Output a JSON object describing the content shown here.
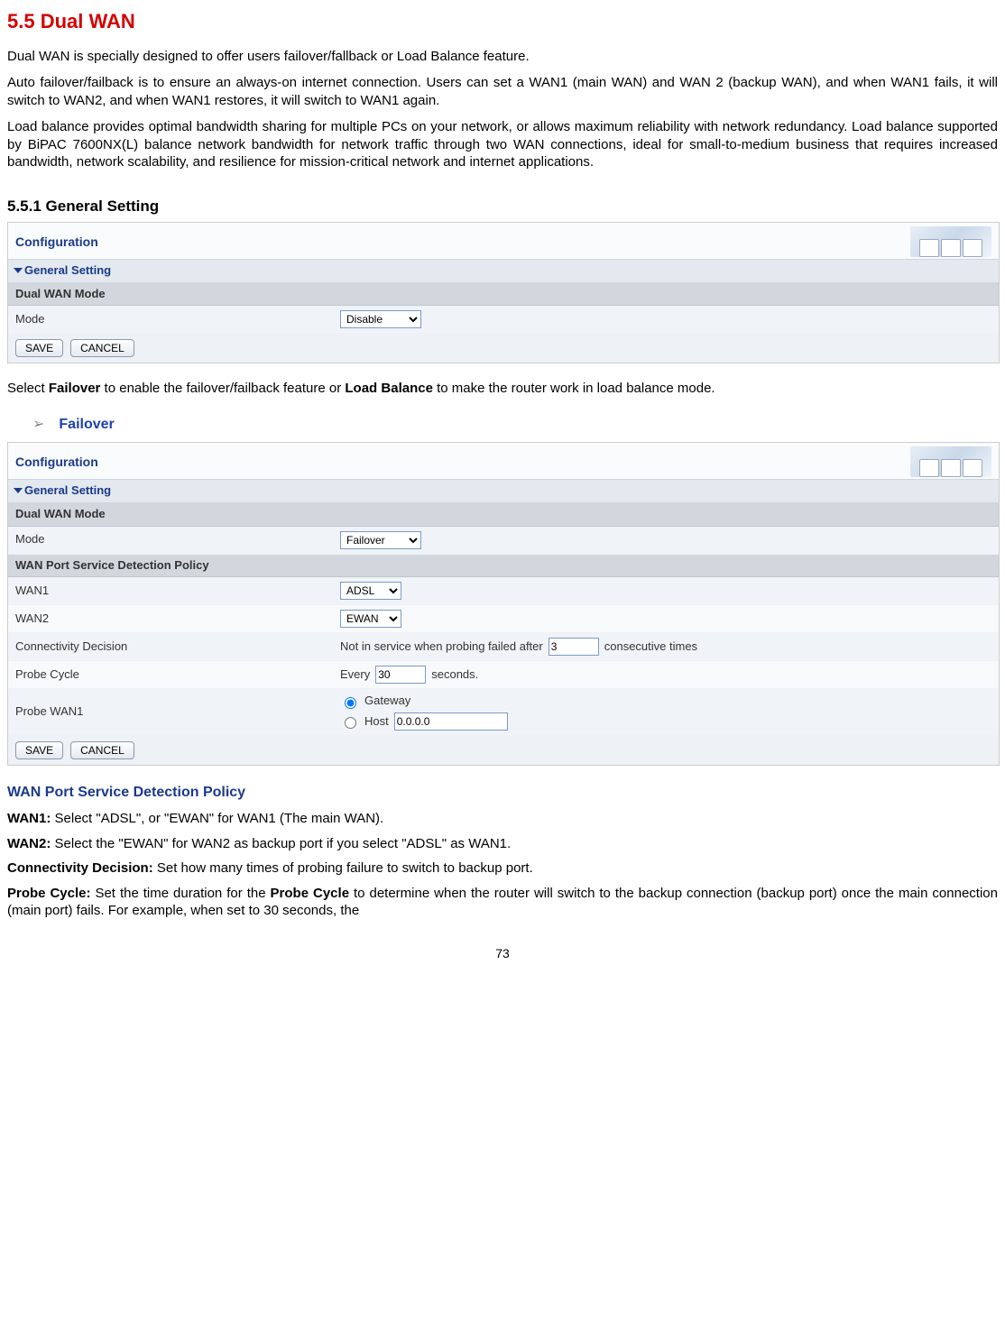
{
  "section_title": "5.5 Dual WAN",
  "paragraphs": {
    "p1": "Dual WAN is specially designed to offer users failover/fallback or Load Balance feature.",
    "p2": "Auto failover/failback is to ensure an always-on internet connection. Users can set a WAN1 (main WAN) and WAN 2 (backup WAN), and when WAN1 fails, it will switch to WAN2, and when WAN1 restores, it will switch to WAN1 again.",
    "p3": "Load balance provides optimal bandwidth sharing for multiple PCs on your network, or allows maximum reliability with network redundancy. Load balance supported by BiPAC 7600NX(L) balance network bandwidth for network traffic through two WAN connections, ideal for small-to-medium business that requires increased bandwidth, network scalability, and resilience for mission-critical network and internet applications."
  },
  "subheading": "5.5.1 General Setting",
  "panel1": {
    "config_title": "Configuration",
    "section_label": "General Setting",
    "subsection_label": "Dual WAN Mode",
    "mode_label": "Mode",
    "mode_value": "Disable",
    "save_label": "SAVE",
    "cancel_label": "CANCEL"
  },
  "select_note": {
    "pre": "Select ",
    "b1": "Failover",
    "mid": " to enable the failover/failback feature or ",
    "b2": "Load Balance",
    "post": " to make the router work in load balance mode."
  },
  "bullet": {
    "arrow": "➢",
    "label": "Failover"
  },
  "panel2": {
    "config_title": "Configuration",
    "section_label": "General Setting",
    "subsection1": "Dual WAN Mode",
    "mode_label": "Mode",
    "mode_value": "Failover",
    "subsection2": "WAN Port Service Detection Policy",
    "wan1_label": "WAN1",
    "wan1_value": "ADSL",
    "wan2_label": "WAN2",
    "wan2_value": "EWAN",
    "conn_label": "Connectivity Decision",
    "conn_pre": "Not in service when probing failed after",
    "conn_value": "3",
    "conn_post": "consecutive times",
    "probe_cycle_label": "Probe Cycle",
    "probe_cycle_pre": "Every",
    "probe_cycle_value": "30",
    "probe_cycle_post": "seconds.",
    "probe_wan1_label": "Probe WAN1",
    "gateway_label": "Gateway",
    "host_label": "Host",
    "host_value": "0.0.0.0",
    "save_label": "SAVE",
    "cancel_label": "CANCEL"
  },
  "desc": {
    "heading": "WAN Port Service Detection Policy",
    "wan1_b": "WAN1:",
    "wan1_t": " Select \"ADSL\", or \"EWAN\" for WAN1 (The main WAN).",
    "wan2_b": "WAN2:",
    "wan2_t": " Select the \"EWAN\" for WAN2 as backup port if you select \"ADSL\" as WAN1.",
    "cd_b": "Connectivity Decision:",
    "cd_t": " Set how many times of probing failure to switch to backup port.",
    "pc_b": "Probe Cycle:",
    "pc_t1": " Set the time duration for the ",
    "pc_b2": "Probe Cycle",
    "pc_t2": " to determine when the router will switch to the backup connection (backup port) once the main connection (main port) fails. For example, when set to 30 seconds, the"
  },
  "page_number": "73"
}
